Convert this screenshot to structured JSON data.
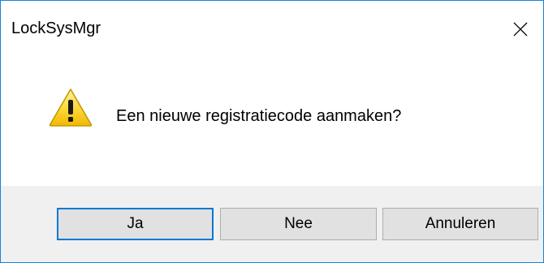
{
  "window": {
    "title": "LockSysMgr",
    "close_icon": "close-icon",
    "border_color": "#1883d7"
  },
  "dialog": {
    "icon": "warning-icon",
    "message": "Een nieuwe registratiecode aanmaken?"
  },
  "buttons": {
    "yes_label": "Ja",
    "no_label": "Nee",
    "cancel_label": "Annuleren",
    "default_border_color": "#0078d7"
  }
}
